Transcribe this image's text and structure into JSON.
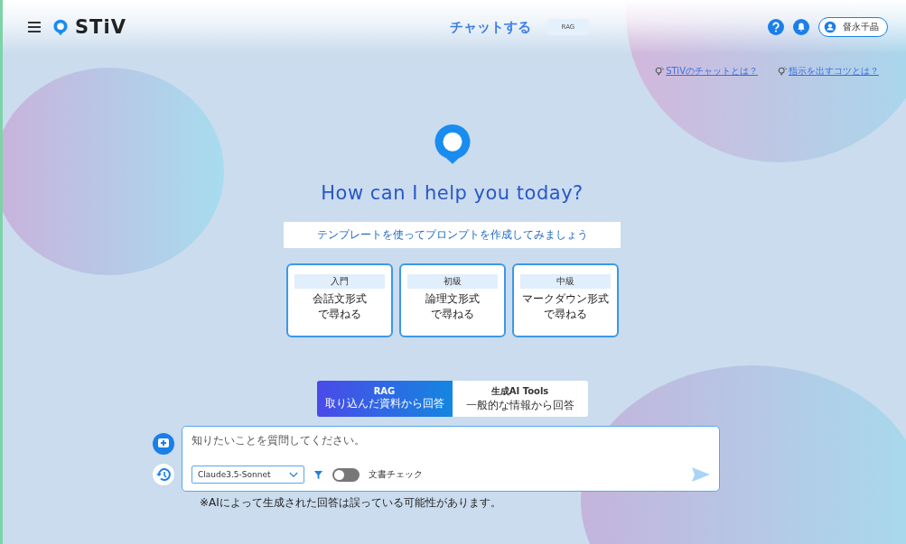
{
  "header": {
    "logo": "STiV",
    "title": "チャットする",
    "mode_badge": "RAG",
    "user": "督永千晶"
  },
  "help_links": [
    "STiVのチャットとは？",
    "指示を出すコツとは？"
  ],
  "greeting": "How can I help you today?",
  "template_hint": "テンプレートを使ってプロンプトを作成してみましょう",
  "templates": [
    {
      "level": "入門",
      "title": "会話文形式",
      "sub": "で尋ねる"
    },
    {
      "level": "初級",
      "title": "論理文形式",
      "sub": "で尋ねる"
    },
    {
      "level": "中級",
      "title": "マークダウン形式",
      "sub": "で尋ねる"
    }
  ],
  "modes": [
    {
      "label": "RAG",
      "sub": "取り込んだ資料から回答",
      "selected": true
    },
    {
      "label": "生成AI Tools",
      "sub": "一般的な情報から回答",
      "selected": false
    }
  ],
  "input": {
    "placeholder": "知りたいことを質問してください。",
    "model": "Claude3.5-Sonnet",
    "doc_check": {
      "label": "文書チェック",
      "on": false
    }
  },
  "disclaimer": "※AIによって生成された回答は誤っている可能性があります。"
}
